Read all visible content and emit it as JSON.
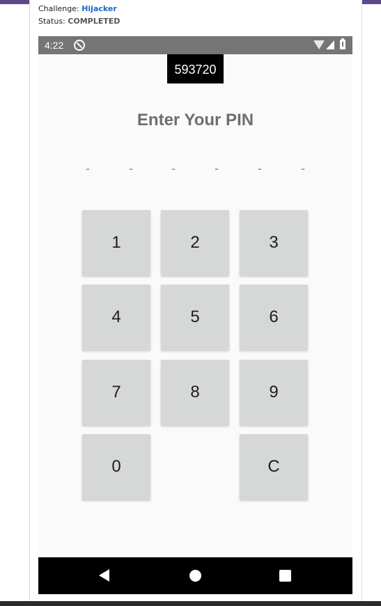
{
  "header": {
    "challenge_label": "Challenge:",
    "challenge_name": "Hijacker",
    "status_label": "Status:",
    "status_value": "COMPLETED"
  },
  "statusbar": {
    "time": "4:22"
  },
  "app": {
    "code": "593720",
    "title": "Enter Your PIN",
    "pin_slots": [
      "-",
      "-",
      "-",
      "-",
      "-",
      "-"
    ],
    "keys": {
      "k1": "1",
      "k2": "2",
      "k3": "3",
      "k4": "4",
      "k5": "5",
      "k6": "6",
      "k7": "7",
      "k8": "8",
      "k9": "9",
      "k0": "0",
      "clear": "C"
    }
  },
  "colors": {
    "accent": "#5d4a8c",
    "link": "#1a66c8",
    "key_bg": "#d6d7d7",
    "status_bar": "#757575"
  }
}
